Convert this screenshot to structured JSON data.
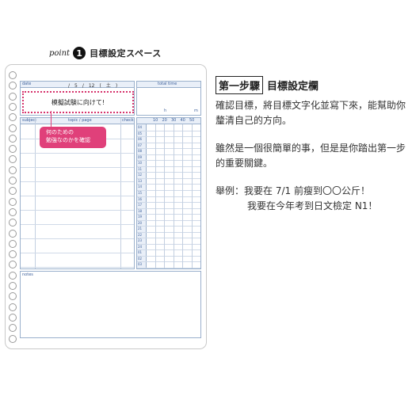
{
  "header": {
    "point_word": "point",
    "point_number": "1",
    "title": "目標設定スペース"
  },
  "sheet": {
    "date_label": "date",
    "date_value": "/　5　/　12　(　土　)",
    "total_time_label": "total time",
    "h_label": "h",
    "m_label": "m",
    "goal_text": "模擬試験に向けて!",
    "subject_label": "subject",
    "topic_label": "topic / page",
    "check_label": "check",
    "minute_ticks": [
      "10",
      "20",
      "30",
      "40",
      "50"
    ],
    "hours": [
      "04",
      "05",
      "06",
      "07",
      "08",
      "09",
      "10",
      "11",
      "12",
      "13",
      "14",
      "15",
      "16",
      "17",
      "18",
      "19",
      "20",
      "21",
      "22",
      "23",
      "24",
      "01",
      "02",
      "03"
    ],
    "notes_label": "notes",
    "callout_line1": "何のための",
    "callout_line2": "勉強なのかを確認"
  },
  "explanation": {
    "title_boxed": "第一步驟",
    "title_rest": "目標設定欄",
    "para1": "確認目標，將目標文字化並寫下來，能幫助你釐清自己的方向。",
    "para2": "雖然是一個很簡單的事，但是是你踏出第一步的重要關鍵。",
    "para3_line1": "舉例：我要在 7/1 前瘦到〇〇公斤！",
    "para3_line2": "我要在今年考到日文檢定 N1！"
  }
}
